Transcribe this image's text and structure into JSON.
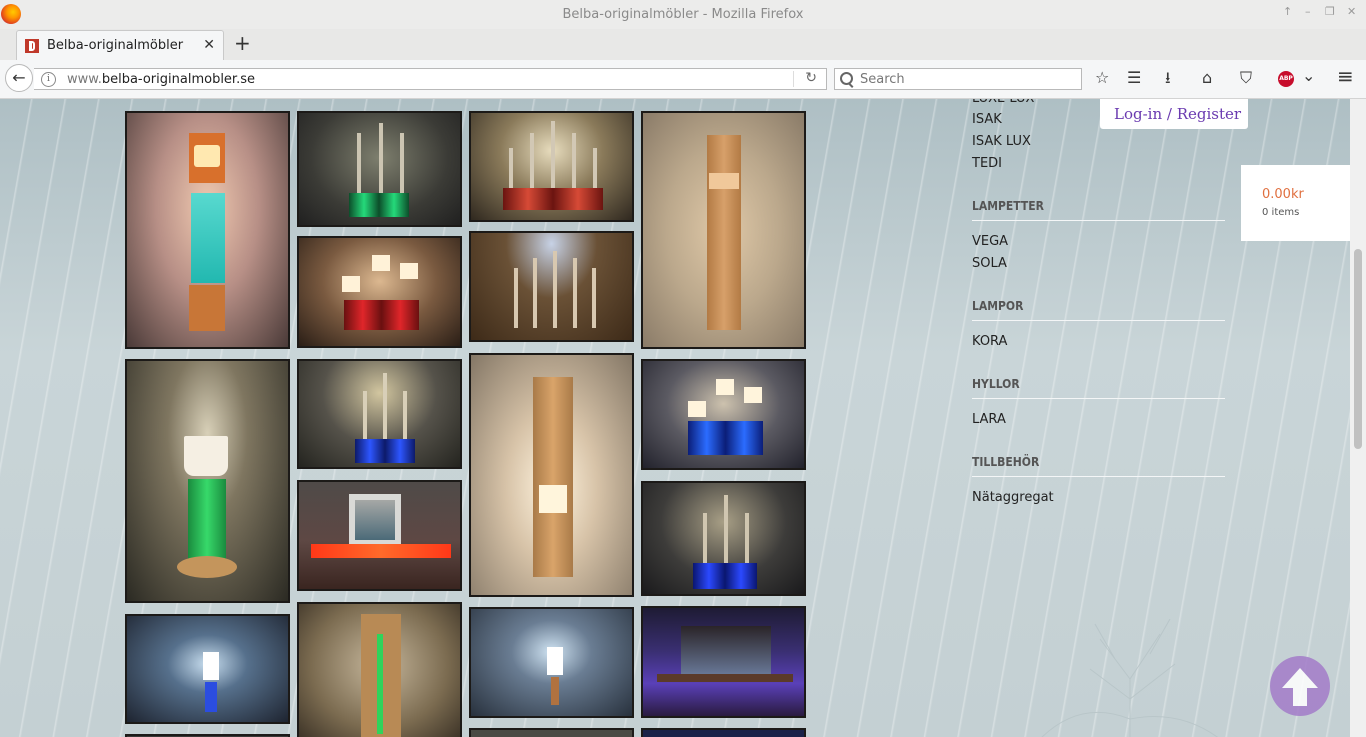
{
  "window": {
    "title": "Belba-originalmöbler - Mozilla Firefox",
    "controls": [
      "↑",
      "–",
      "❐",
      "✕"
    ]
  },
  "tab": {
    "title": "Belba-originalmöbler",
    "close": "✕",
    "new_tab": "+"
  },
  "nav": {
    "back": "←",
    "info": "i",
    "url_prefix": "www.",
    "url_domain": "belba-originalmobler.se",
    "reload": "↻",
    "search_placeholder": "Search",
    "toolbar_icons": [
      "☆",
      "☰",
      "⭳",
      "⌂",
      "⛉",
      "⌄",
      "≡"
    ],
    "abp": "ABP"
  },
  "sidebar": {
    "partial_item": "LUXE LUX",
    "group1": [
      "ISAK",
      "ISAK LUX",
      "TEDI"
    ],
    "headings": [
      "LAMPETTER",
      "LAMPOR",
      "HYLLOR",
      "TILLBEHÖR"
    ],
    "lampetter": [
      "VEGA",
      "SOLA"
    ],
    "lampor": [
      "KORA"
    ],
    "hyllor": [
      "LARA"
    ],
    "tillbehor": [
      "Nätaggregat"
    ]
  },
  "login": "Log-in / Register",
  "cart": {
    "total": "0.00kr",
    "items": "0 items"
  },
  "colors": {
    "accent_cart": "#e07040",
    "login_text": "#6a3ab0",
    "to_top": "#a37cc9"
  },
  "gallery_icons": [
    "wall-lamp-teal",
    "candelabra-3-green",
    "candelabra-5-red",
    "wall-sconce-wood",
    "tealight-3-red",
    "candelabra-5-blue-light",
    "lantern-green",
    "candelabra-3-blue",
    "wall-lamp-tealight",
    "tealight-3-blue",
    "shelf-red-picture",
    "candelabra-3-blue-2",
    "lamp-white",
    "wall-lamp-green",
    "lamp-white-2",
    "shelf-blue-picture"
  ]
}
